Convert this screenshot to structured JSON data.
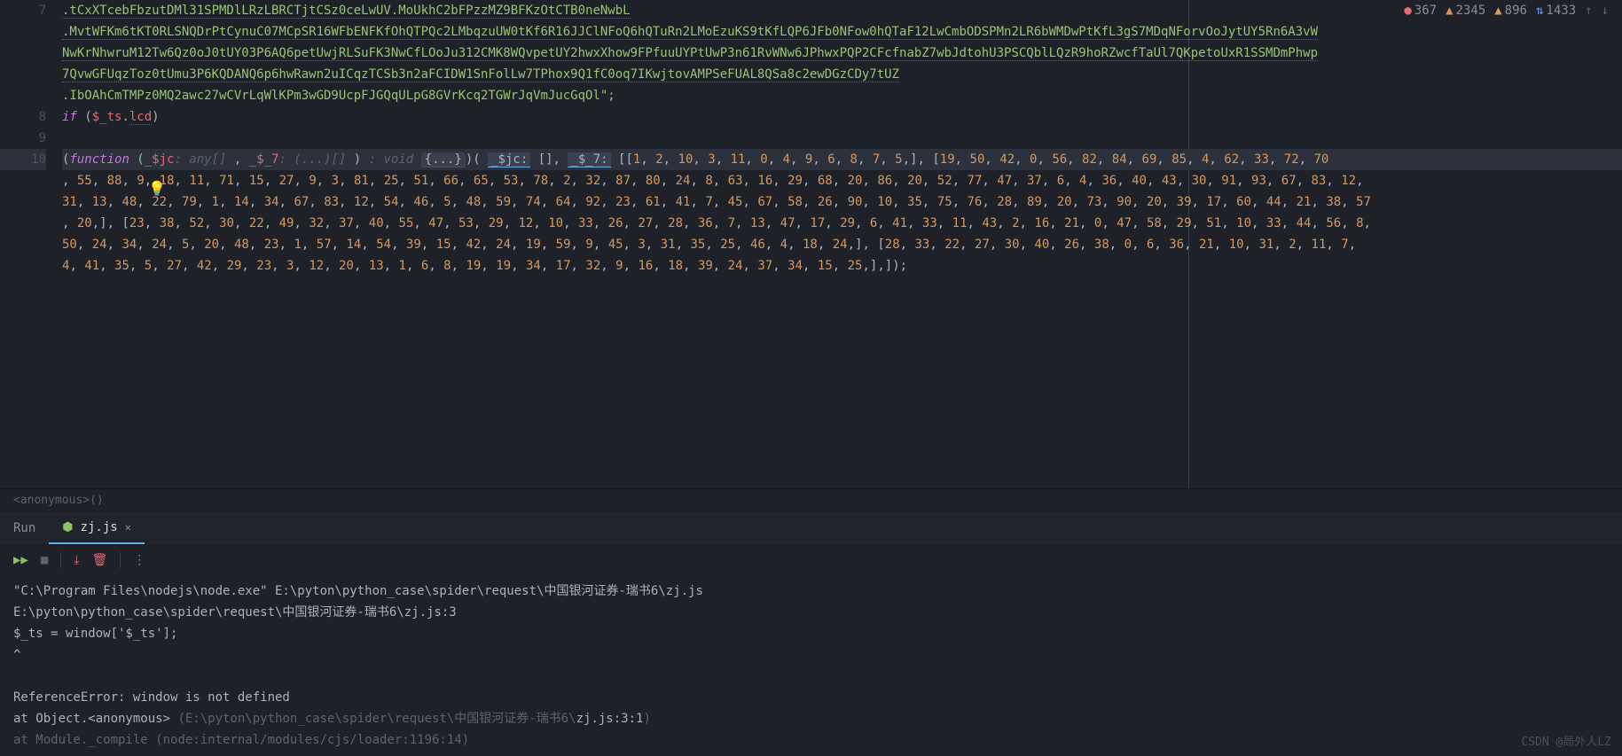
{
  "status": {
    "errors": "367",
    "warnings1": "2345",
    "warnings2": "896",
    "sort": "1433"
  },
  "gutter": {
    "l7": "7",
    "l8": "8",
    "l9": "9",
    "l10": "10"
  },
  "code": {
    "l7a": ".tCxXTcebFbzutDMl31SPMDlLRzLBRCTjtCSz0ceLwUV.MoUkhC2bFPzzMZ9BFKzOtCTB0neNwbL",
    "l7b": ".MvtWFKm6tKT0RLSNQDrPtCynuC07MCpSR16WFbENFKfOhQTPQc2LMbqzuUW0tKf6R16JJClNFoQ6hQTuRn2LMoEzuKS9tKfLQP6JFb0NFow0hQTaF12LwCmbODSPMn2LR6bWMDwPtKfL3gS7MDqNForvOoJytUY5Rn6A3vW",
    "l7c": "NwKrNhwruM12Tw6Qz0oJ0tUY03P6AQ6petUwjRLSuFK3NwCfLOoJu312CMK8WQvpetUY2hwxXhow9FPfuuUYPtUwP3n61RνWNw6JPhwxPQP2CFcfnabZ7wbJdtohU3PSCQblLQzR9hoRZwcfTaUl7QKpetoUxR1SSMDmPhwp",
    "l7d": "7QvwGFUqzToz0tUmu3P6KQDANQ6p6hwRawn2uICqzTCSb3n2aFCIDW1SnFolLw7TPhox9Q1fC0oq7IKwjtovAMPSeFUAL8QSa8c2ewDGzCDy7tUZ",
    "l7e": ".IbOAhCmTMPz0MQ2awc27wCVrLqWlKPm3wGD9UcpFJGQqULpG8GVrKcq2TGWrJqVmJucGqOl\";",
    "l8_if": "if",
    "l8_var": "$_ts",
    "l8_prop": "lcd",
    "l10_fn": "function",
    "l10_p1": "_$jc",
    "l10_t1": ": any[]",
    "l10_p2": "_$_7",
    "l10_t2": ": (...)[]",
    "l10_ret": ": void",
    "l10_fold": "{...}",
    "l10_arg1": "_$jc:",
    "l10_arg2": "_$_7:",
    "numbers": "[[1, 2, 10, 3, 11, 0, 4, 9, 6, 8, 7, 5,], [19, 50, 42, 0, 56, 82, 84, 69, 85, 4, 62, 33, 72, 70, 55, 88, 9, 18, 11, 71, 15, 27, 9, 3, 81, 25, 51, 66, 65, 53, 78, 2, 32, 87, 80, 24, 8, 63, 16, 29, 68, 20, 86, 20, 52, 77, 47, 37, 6, 4, 36, 40, 43, 30, 91, 93, 67, 83, 12, 31, 13, 48, 22, 79, 1, 14, 34, 67, 83, 12, 54, 46, 5, 48, 59, 74, 64, 92, 23, 61, 41, 7, 45, 67, 58, 26, 90, 10, 35, 75, 76, 28, 89, 20, 73, 90, 20, 39, 17, 60, 44, 21, 38, 57, 20,], [23, 38, 52, 30, 22, 49, 32, 37, 40, 55, 47, 53, 29, 12, 10, 33, 26, 27, 28, 36, 7, 13, 47, 17, 29, 6, 41, 33, 11, 43, 2, 16, 21, 0, 47, 58, 29, 51, 10, 33, 44, 56, 8, 50, 24, 34, 24, 5, 20, 48, 23, 1, 57, 14, 54, 39, 15, 42, 24, 19, 59, 9, 45, 3, 31, 35, 25, 46, 4, 18, 24,], [28, 33, 22, 27, 30, 40, 26, 38, 0, 6, 36, 21, 10, 31, 2, 11, 7, 4, 41, 35, 5, 27, 42, 29, 23, 3, 12, 20, 13, 1, 6, 8, 19, 19, 34, 17, 32, 9, 16, 18, 39, 24, 37, 34, 15, 25,],]);"
  },
  "breadcrumb": "<anonymous>()",
  "tabs": {
    "run": "Run",
    "file": "zj.js"
  },
  "console": {
    "l1": "\"C:\\Program Files\\nodejs\\node.exe\" E:\\pyton\\python_case\\spider\\request\\中国银河证券-瑞书6\\zj.js",
    "l2": "E:\\pyton\\python_case\\spider\\request\\中国银河证券-瑞书6\\zj.js:3",
    "l3": "$_ts = window['$_ts'];",
    "l4": "^",
    "l5": "ReferenceError: window is not defined",
    "l6a": "    at Object.<anonymous> ",
    "l6b": "(E:\\pyton\\python_case\\spider\\request\\中国银河证券-瑞书6\\",
    "l6c": "zj.js:3:1",
    "l6d": ")",
    "l7": "    at Module._compile (node:internal/modules/cjs/loader:1196:14)"
  },
  "watermark": "CSDN @局外人LZ"
}
